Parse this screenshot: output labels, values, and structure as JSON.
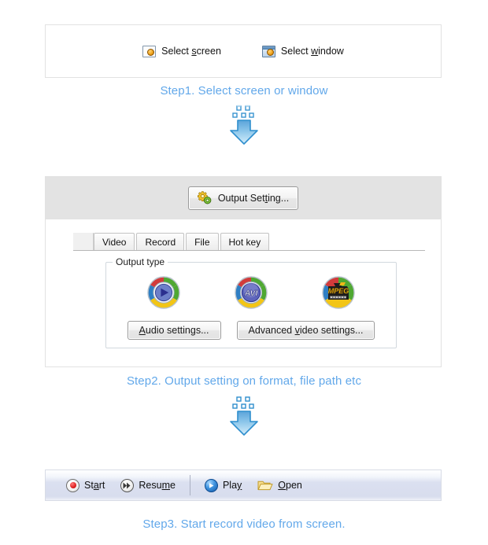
{
  "accent_color": "#62a8ea",
  "steps": [
    {
      "id": "step1",
      "caption": "Step1. Select screen or window"
    },
    {
      "id": "step2",
      "caption": "Step2. Output setting on format, file path etc"
    },
    {
      "id": "step3",
      "caption": "Step3. Start record video from screen."
    }
  ],
  "select_panel": {
    "items": [
      {
        "icon": "screen-icon",
        "label_pre": "Select ",
        "label_key": "s",
        "label_post": "creen"
      },
      {
        "icon": "window-icon",
        "label_pre": "Select ",
        "label_key": "w",
        "label_post": "indow"
      }
    ]
  },
  "output_panel": {
    "setting_button": {
      "icon": "gear-icon",
      "label_pre": "Output Set",
      "label_key": "t",
      "label_post": "ing..."
    },
    "tabs": [
      {
        "label": "Video",
        "selected": true
      },
      {
        "label": "Record",
        "selected": false
      },
      {
        "label": "File",
        "selected": false
      },
      {
        "label": "Hot key",
        "selected": false
      }
    ],
    "group": {
      "title": "Output type",
      "formats": [
        {
          "name": "wmv-format-icon",
          "label": ""
        },
        {
          "name": "avi-format-icon",
          "label": "AVI"
        },
        {
          "name": "mpeg-format-icon",
          "label": "MPEG"
        }
      ],
      "buttons": [
        {
          "name": "audio-settings-button",
          "label_pre": "",
          "label_key": "A",
          "label_post": "udio settings..."
        },
        {
          "name": "advanced-video-settings-button",
          "label_pre": "Advanced ",
          "label_key": "v",
          "label_post": "ideo settings..."
        }
      ]
    }
  },
  "toolbar": {
    "items": [
      {
        "name": "start-button",
        "icon": "record-icon",
        "label_pre": "St",
        "label_key": "a",
        "label_post": "rt"
      },
      {
        "name": "resume-button",
        "icon": "resume-icon",
        "label_pre": "Resu",
        "label_key": "m",
        "label_post": "e"
      },
      {
        "name": "play-button",
        "icon": "play-icon",
        "label_pre": "Pla",
        "label_key": "y",
        "label_post": ""
      },
      {
        "name": "open-button",
        "icon": "folder-open-icon",
        "label_pre": "",
        "label_key": "O",
        "label_post": "pen"
      }
    ]
  },
  "arrows": [
    {
      "name": "step1-to-step2-arrow"
    },
    {
      "name": "step2-to-step3-arrow"
    }
  ]
}
